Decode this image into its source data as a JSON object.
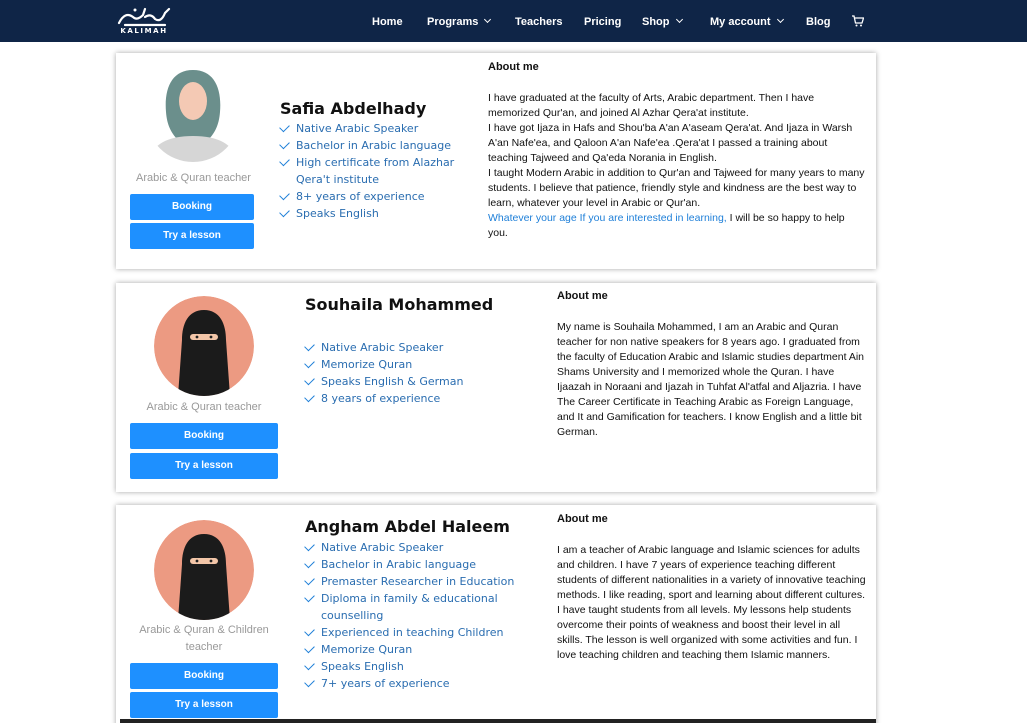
{
  "nav": {
    "logo_text": "KALIMAH",
    "items": [
      {
        "label": "Home",
        "dropdown": false
      },
      {
        "label": "Programs",
        "dropdown": true
      },
      {
        "label": "Teachers",
        "dropdown": false
      },
      {
        "label": "Pricing",
        "dropdown": false
      },
      {
        "label": "Shop",
        "dropdown": true
      },
      {
        "label": "My account",
        "dropdown": true
      },
      {
        "label": "Blog",
        "dropdown": false
      }
    ],
    "cart_icon": "cart-icon",
    "colors": {
      "bar": "#0f2547",
      "text": "#ffffff"
    }
  },
  "colors": {
    "accent": "#1e90ff",
    "check": "#1e7fd8",
    "qual_text": "#2a6db0",
    "role_text": "#999999"
  },
  "teachers": [
    {
      "name": "Safia Abdelhady",
      "role": "Arabic & Quran teacher",
      "avatar": "hijab-grey-avatar",
      "booking_label": "Booking",
      "trial_label": "Try a lesson",
      "qualifications": [
        "Native Arabic Speaker",
        "Bachelor in Arabic language",
        "High certificate from Alazhar Qera't institute",
        "8+ years of experience",
        "Speaks English"
      ],
      "about_title": "About me",
      "about_p1": "I have graduated at the faculty of Arts, Arabic department. Then I have memorized Qur'an, and joined Al Azhar Qera'at institute.",
      "about_p2": "I have got Ijaza in Hafs and Shou'ba A'an A'aseam Qera'at. And Ijaza in Warsh A'an Nafe'ea, and Qaloon A'an Nafe'ea .Qera'at I passed a training about teaching Tajweed and Qa'eda Norania in English.",
      "about_p3": "I taught Modern Arabic in addition to Qur'an and Tajweed for many years to many students. I believe that patience, friendly style and kindness are the best way to learn, whatever your level in Arabic or Qur'an.",
      "about_highlight": "Whatever your age If you are interested in learning,",
      "about_end": " I will be so happy to help you."
    },
    {
      "name": "Souhaila Mohammed",
      "role": "Arabic & Quran teacher",
      "avatar": "niqab-avatar",
      "booking_label": "Booking",
      "trial_label": "Try a lesson",
      "qualifications": [
        "Native Arabic Speaker",
        "Memorize Quran",
        "Speaks English & German",
        "8 years of experience"
      ],
      "about_title": "About me",
      "about_text": "My name is Souhaila Mohammed, I am an Arabic and Quran teacher for non native speakers for 8 years ago. I graduated from the faculty of Education Arabic and Islamic studies department Ain Shams University and I memorized whole the Quran. I have Ijaazah in Noraani and Ijazah in Tuhfat Al'atfal and Aljazria. I have The Career Certificate in Teaching Arabic as Foreign Language, and It and Gamification for teachers. I know English and a little bit German."
    },
    {
      "name": "Angham Abdel Haleem",
      "role": "Arabic & Quran & Children teacher",
      "avatar": "niqab-avatar",
      "booking_label": "Booking",
      "trial_label": "Try a lesson",
      "qualifications": [
        "Native Arabic Speaker",
        "Bachelor in Arabic language",
        "Premaster Researcher in Education",
        "Diploma in family & educational counselling",
        "Experienced in teaching Children",
        "Memorize Quran",
        "Speaks English",
        "7+ years of experience"
      ],
      "about_title": "About me",
      "about_text": "I am a teacher of Arabic language and Islamic sciences for adults and children. I have 7 years of experience teaching different students of different nationalities in a variety of innovative teaching methods. I like reading, sport and learning about different cultures. I have taught students from all levels. My lessons help students overcome their points of weakness and boost their level in all skills. The lesson is well organized with some activities and fun. I love teaching children and teaching them Islamic manners."
    }
  ]
}
